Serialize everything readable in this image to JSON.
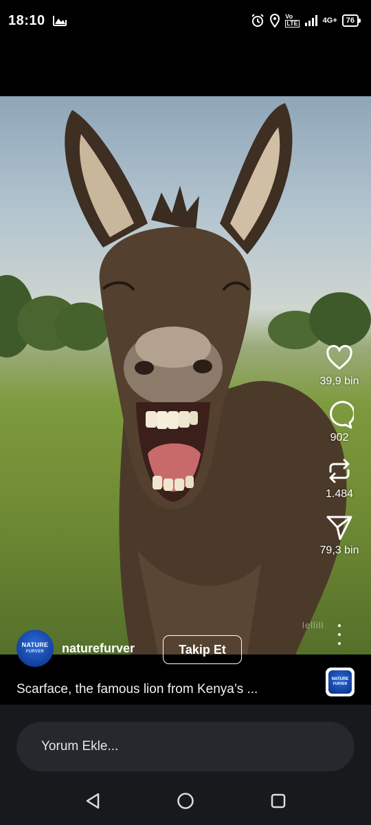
{
  "status": {
    "time": "18:10",
    "volte": "Vo",
    "lte": "LTE",
    "network": "4G+",
    "battery": "76"
  },
  "reel": {
    "watermark": "lellill",
    "actions": {
      "likes": "39,9 bin",
      "comments": "902",
      "reposts": "1.484",
      "shares": "79,3 bin"
    },
    "owner": {
      "username": "naturefurver",
      "avatar_line1": "NATURE",
      "avatar_line2": "FURVER",
      "follow_label": "Takip Et"
    },
    "caption": "Scarface, the famous lion from Kenya’s ..."
  },
  "comment": {
    "placeholder": "Yorum Ekle..."
  },
  "colors": {
    "accent": "#ffffff",
    "avatar_blue": "#1a4fb4"
  }
}
